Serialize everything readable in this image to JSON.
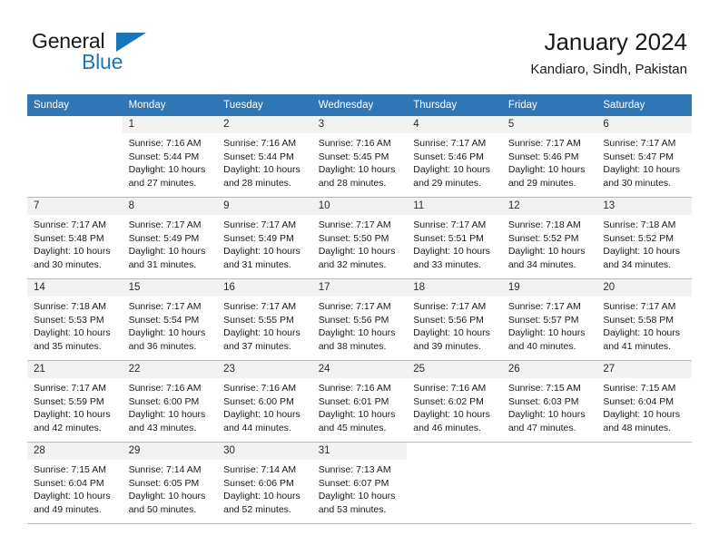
{
  "brand": {
    "name_part1": "General",
    "name_part2": "Blue",
    "accent_color": "#1b75bb",
    "logo_icon": "triangle-logo-mark"
  },
  "header": {
    "title": "January 2024",
    "subtitle": "Kandiaro, Sindh, Pakistan"
  },
  "calendar": {
    "header_color": "#3076b5",
    "weekdays": [
      "Sunday",
      "Monday",
      "Tuesday",
      "Wednesday",
      "Thursday",
      "Friday",
      "Saturday"
    ],
    "weeks": [
      [
        {
          "day": "",
          "sunrise": "",
          "sunset": "",
          "daylight_line1": "",
          "daylight_line2": "",
          "blank": true
        },
        {
          "day": "1",
          "sunrise": "Sunrise: 7:16 AM",
          "sunset": "Sunset: 5:44 PM",
          "daylight_line1": "Daylight: 10 hours",
          "daylight_line2": "and 27 minutes."
        },
        {
          "day": "2",
          "sunrise": "Sunrise: 7:16 AM",
          "sunset": "Sunset: 5:44 PM",
          "daylight_line1": "Daylight: 10 hours",
          "daylight_line2": "and 28 minutes."
        },
        {
          "day": "3",
          "sunrise": "Sunrise: 7:16 AM",
          "sunset": "Sunset: 5:45 PM",
          "daylight_line1": "Daylight: 10 hours",
          "daylight_line2": "and 28 minutes."
        },
        {
          "day": "4",
          "sunrise": "Sunrise: 7:17 AM",
          "sunset": "Sunset: 5:46 PM",
          "daylight_line1": "Daylight: 10 hours",
          "daylight_line2": "and 29 minutes."
        },
        {
          "day": "5",
          "sunrise": "Sunrise: 7:17 AM",
          "sunset": "Sunset: 5:46 PM",
          "daylight_line1": "Daylight: 10 hours",
          "daylight_line2": "and 29 minutes."
        },
        {
          "day": "6",
          "sunrise": "Sunrise: 7:17 AM",
          "sunset": "Sunset: 5:47 PM",
          "daylight_line1": "Daylight: 10 hours",
          "daylight_line2": "and 30 minutes."
        }
      ],
      [
        {
          "day": "7",
          "sunrise": "Sunrise: 7:17 AM",
          "sunset": "Sunset: 5:48 PM",
          "daylight_line1": "Daylight: 10 hours",
          "daylight_line2": "and 30 minutes."
        },
        {
          "day": "8",
          "sunrise": "Sunrise: 7:17 AM",
          "sunset": "Sunset: 5:49 PM",
          "daylight_line1": "Daylight: 10 hours",
          "daylight_line2": "and 31 minutes."
        },
        {
          "day": "9",
          "sunrise": "Sunrise: 7:17 AM",
          "sunset": "Sunset: 5:49 PM",
          "daylight_line1": "Daylight: 10 hours",
          "daylight_line2": "and 31 minutes."
        },
        {
          "day": "10",
          "sunrise": "Sunrise: 7:17 AM",
          "sunset": "Sunset: 5:50 PM",
          "daylight_line1": "Daylight: 10 hours",
          "daylight_line2": "and 32 minutes."
        },
        {
          "day": "11",
          "sunrise": "Sunrise: 7:17 AM",
          "sunset": "Sunset: 5:51 PM",
          "daylight_line1": "Daylight: 10 hours",
          "daylight_line2": "and 33 minutes."
        },
        {
          "day": "12",
          "sunrise": "Sunrise: 7:18 AM",
          "sunset": "Sunset: 5:52 PM",
          "daylight_line1": "Daylight: 10 hours",
          "daylight_line2": "and 34 minutes."
        },
        {
          "day": "13",
          "sunrise": "Sunrise: 7:18 AM",
          "sunset": "Sunset: 5:52 PM",
          "daylight_line1": "Daylight: 10 hours",
          "daylight_line2": "and 34 minutes."
        }
      ],
      [
        {
          "day": "14",
          "sunrise": "Sunrise: 7:18 AM",
          "sunset": "Sunset: 5:53 PM",
          "daylight_line1": "Daylight: 10 hours",
          "daylight_line2": "and 35 minutes."
        },
        {
          "day": "15",
          "sunrise": "Sunrise: 7:17 AM",
          "sunset": "Sunset: 5:54 PM",
          "daylight_line1": "Daylight: 10 hours",
          "daylight_line2": "and 36 minutes."
        },
        {
          "day": "16",
          "sunrise": "Sunrise: 7:17 AM",
          "sunset": "Sunset: 5:55 PM",
          "daylight_line1": "Daylight: 10 hours",
          "daylight_line2": "and 37 minutes."
        },
        {
          "day": "17",
          "sunrise": "Sunrise: 7:17 AM",
          "sunset": "Sunset: 5:56 PM",
          "daylight_line1": "Daylight: 10 hours",
          "daylight_line2": "and 38 minutes."
        },
        {
          "day": "18",
          "sunrise": "Sunrise: 7:17 AM",
          "sunset": "Sunset: 5:56 PM",
          "daylight_line1": "Daylight: 10 hours",
          "daylight_line2": "and 39 minutes."
        },
        {
          "day": "19",
          "sunrise": "Sunrise: 7:17 AM",
          "sunset": "Sunset: 5:57 PM",
          "daylight_line1": "Daylight: 10 hours",
          "daylight_line2": "and 40 minutes."
        },
        {
          "day": "20",
          "sunrise": "Sunrise: 7:17 AM",
          "sunset": "Sunset: 5:58 PM",
          "daylight_line1": "Daylight: 10 hours",
          "daylight_line2": "and 41 minutes."
        }
      ],
      [
        {
          "day": "21",
          "sunrise": "Sunrise: 7:17 AM",
          "sunset": "Sunset: 5:59 PM",
          "daylight_line1": "Daylight: 10 hours",
          "daylight_line2": "and 42 minutes."
        },
        {
          "day": "22",
          "sunrise": "Sunrise: 7:16 AM",
          "sunset": "Sunset: 6:00 PM",
          "daylight_line1": "Daylight: 10 hours",
          "daylight_line2": "and 43 minutes."
        },
        {
          "day": "23",
          "sunrise": "Sunrise: 7:16 AM",
          "sunset": "Sunset: 6:00 PM",
          "daylight_line1": "Daylight: 10 hours",
          "daylight_line2": "and 44 minutes."
        },
        {
          "day": "24",
          "sunrise": "Sunrise: 7:16 AM",
          "sunset": "Sunset: 6:01 PM",
          "daylight_line1": "Daylight: 10 hours",
          "daylight_line2": "and 45 minutes."
        },
        {
          "day": "25",
          "sunrise": "Sunrise: 7:16 AM",
          "sunset": "Sunset: 6:02 PM",
          "daylight_line1": "Daylight: 10 hours",
          "daylight_line2": "and 46 minutes."
        },
        {
          "day": "26",
          "sunrise": "Sunrise: 7:15 AM",
          "sunset": "Sunset: 6:03 PM",
          "daylight_line1": "Daylight: 10 hours",
          "daylight_line2": "and 47 minutes."
        },
        {
          "day": "27",
          "sunrise": "Sunrise: 7:15 AM",
          "sunset": "Sunset: 6:04 PM",
          "daylight_line1": "Daylight: 10 hours",
          "daylight_line2": "and 48 minutes."
        }
      ],
      [
        {
          "day": "28",
          "sunrise": "Sunrise: 7:15 AM",
          "sunset": "Sunset: 6:04 PM",
          "daylight_line1": "Daylight: 10 hours",
          "daylight_line2": "and 49 minutes."
        },
        {
          "day": "29",
          "sunrise": "Sunrise: 7:14 AM",
          "sunset": "Sunset: 6:05 PM",
          "daylight_line1": "Daylight: 10 hours",
          "daylight_line2": "and 50 minutes."
        },
        {
          "day": "30",
          "sunrise": "Sunrise: 7:14 AM",
          "sunset": "Sunset: 6:06 PM",
          "daylight_line1": "Daylight: 10 hours",
          "daylight_line2": "and 52 minutes."
        },
        {
          "day": "31",
          "sunrise": "Sunrise: 7:13 AM",
          "sunset": "Sunset: 6:07 PM",
          "daylight_line1": "Daylight: 10 hours",
          "daylight_line2": "and 53 minutes."
        },
        {
          "day": "",
          "sunrise": "",
          "sunset": "",
          "daylight_line1": "",
          "daylight_line2": "",
          "blank": true
        },
        {
          "day": "",
          "sunrise": "",
          "sunset": "",
          "daylight_line1": "",
          "daylight_line2": "",
          "blank": true
        },
        {
          "day": "",
          "sunrise": "",
          "sunset": "",
          "daylight_line1": "",
          "daylight_line2": "",
          "blank": true
        }
      ]
    ]
  }
}
